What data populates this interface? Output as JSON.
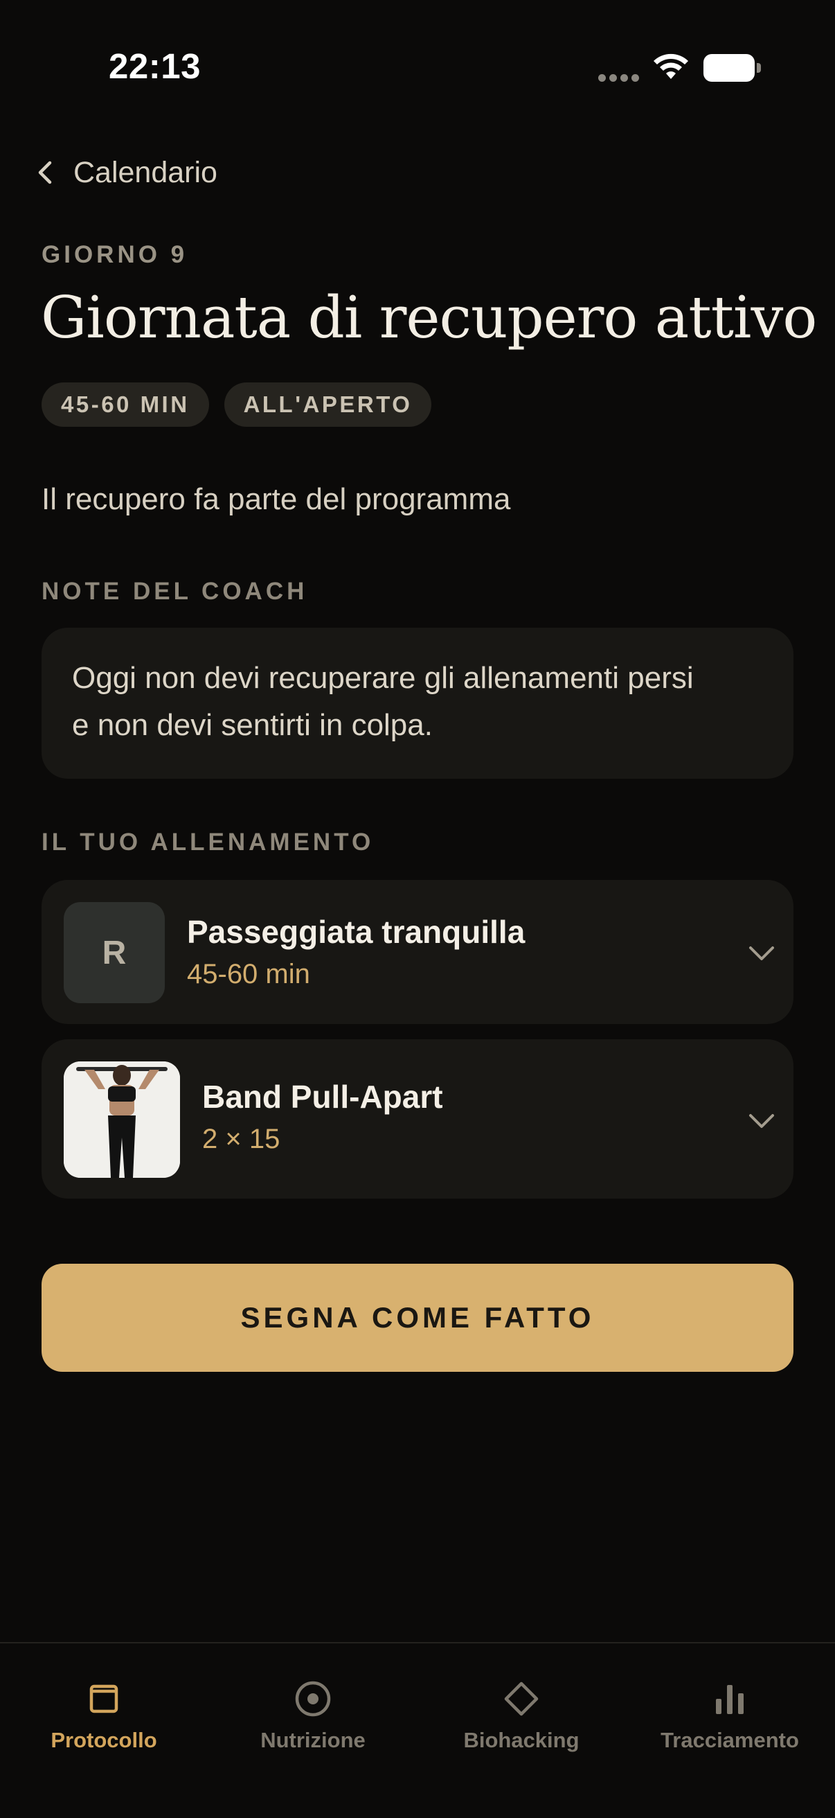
{
  "status_bar": {
    "time": "22:13"
  },
  "nav": {
    "back_label": "Calendario"
  },
  "header": {
    "day_label": "GIORNO 9",
    "title": "Giornata di recupero attivo",
    "tags": [
      "45-60 MIN",
      "ALL'APERTO"
    ]
  },
  "subtitle": "Il recupero fa parte del programma",
  "coach": {
    "section_label": "NOTE DEL COACH",
    "note_line1": "Oggi non devi recuperare gli allenamenti persi",
    "note_line2": "e non devi sentirti in colpa."
  },
  "workout": {
    "section_label": "IL TUO ALLENAMENTO",
    "exercises": [
      {
        "thumb_letter": "R",
        "name": "Passeggiata tranquilla",
        "detail": "45-60 min"
      },
      {
        "name": "Band Pull-Apart",
        "detail": "2 × 15"
      }
    ]
  },
  "action": {
    "done_label": "SEGNA COME FATTO"
  },
  "tab_bar": {
    "tabs": [
      {
        "label": "Protocollo",
        "icon": "calendar-square-icon",
        "active": true
      },
      {
        "label": "Nutrizione",
        "icon": "target-icon",
        "active": false
      },
      {
        "label": "Biohacking",
        "icon": "diamond-icon",
        "active": false
      },
      {
        "label": "Tracciamento",
        "icon": "bar-chart-icon",
        "active": false
      }
    ]
  },
  "colors": {
    "background": "#0b0a09",
    "card": "#181714",
    "accent": "#d8b16f",
    "accent_text": "#d2ad6e",
    "muted_label": "#8f887b"
  }
}
